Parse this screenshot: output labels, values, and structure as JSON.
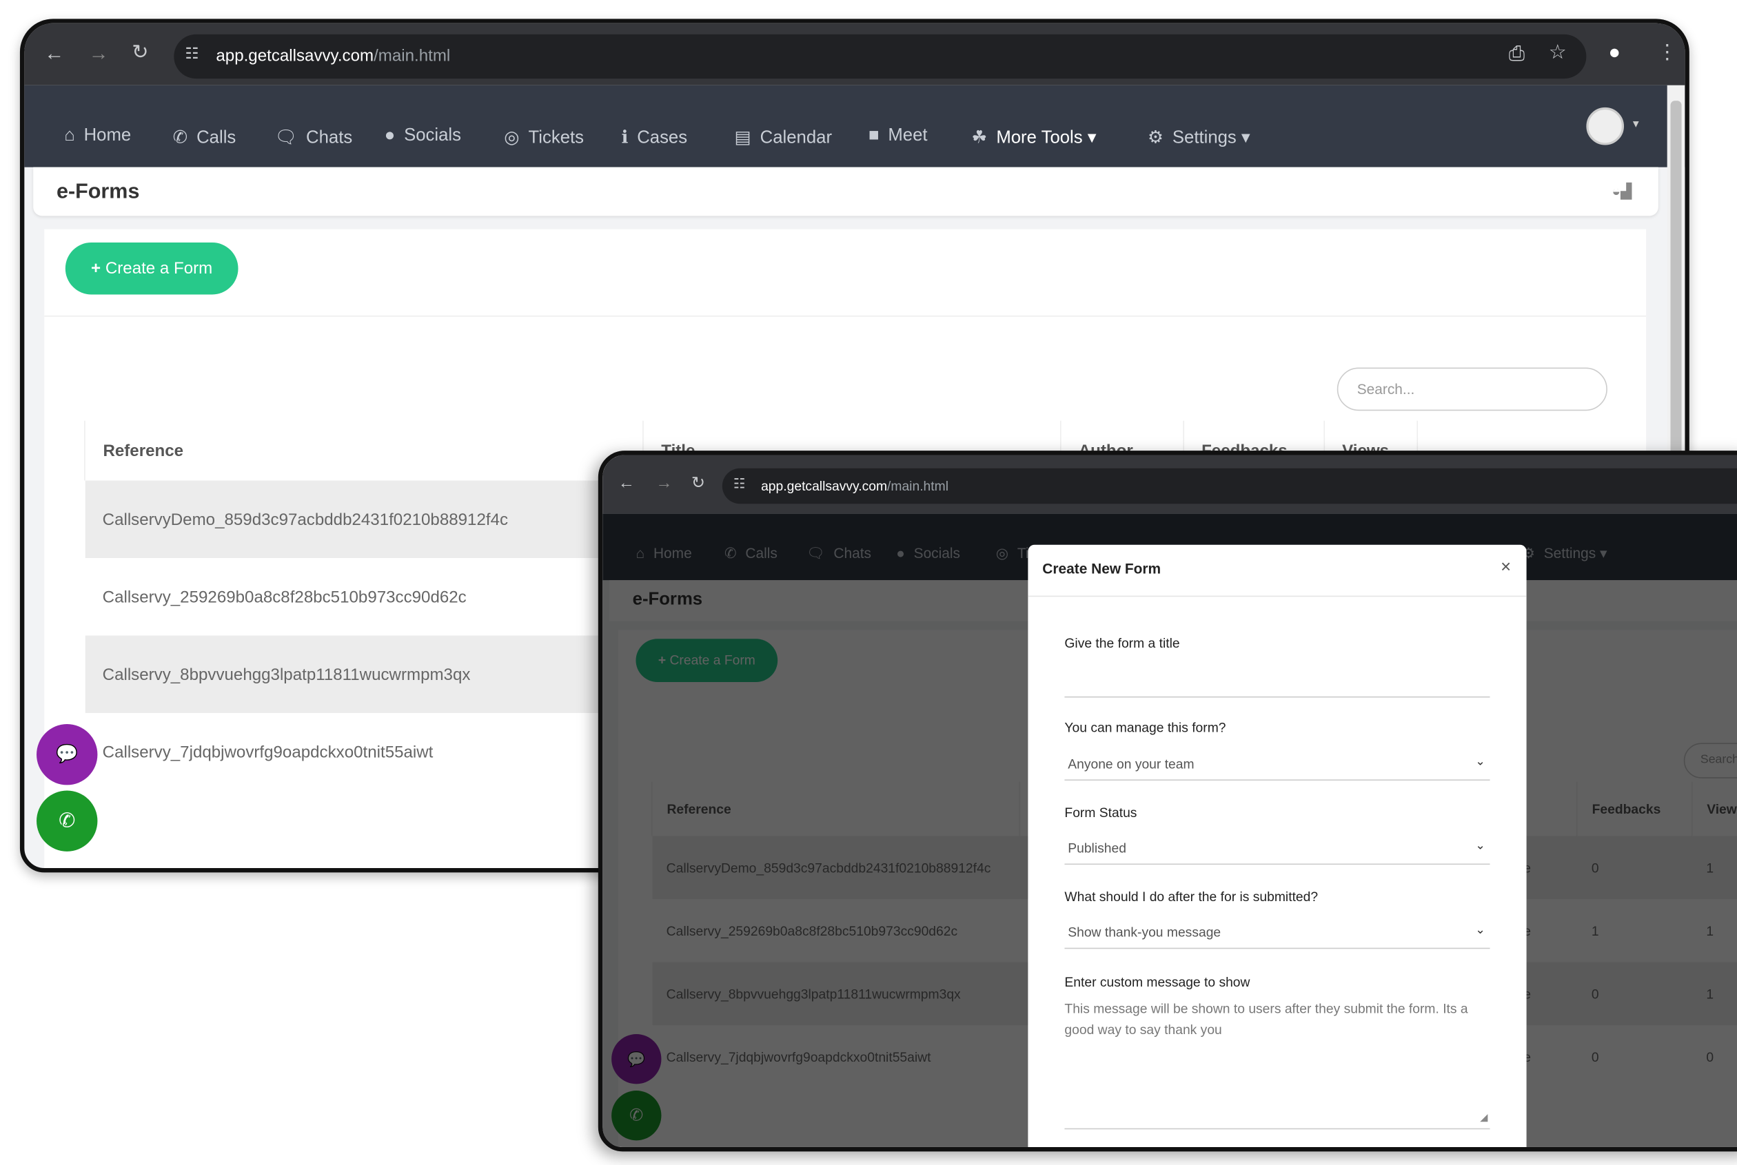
{
  "browser": {
    "url_host": "app.getcallsavvy.com",
    "url_path": "/main.html"
  },
  "nav": {
    "items": [
      {
        "label": "Home",
        "icon": "home-icon",
        "glyph": "⌂"
      },
      {
        "label": "Calls",
        "icon": "phone-icon",
        "glyph": "✆"
      },
      {
        "label": "Chats",
        "icon": "chat-icon",
        "glyph": "🗨"
      },
      {
        "label": "Socials",
        "icon": "comments-icon",
        "glyph": "●"
      },
      {
        "label": "Tickets",
        "icon": "lifebuoy-icon",
        "glyph": "◎"
      },
      {
        "label": "Cases",
        "icon": "info-icon",
        "glyph": "ℹ"
      },
      {
        "label": "Calendar",
        "icon": "calendar-icon",
        "glyph": "▤"
      },
      {
        "label": "Meet",
        "icon": "video-icon",
        "glyph": "■"
      },
      {
        "label": "More Tools ▾",
        "icon": "cubes-icon",
        "glyph": "☘"
      },
      {
        "label": "Settings ▾",
        "icon": "gears-icon",
        "glyph": "⚙"
      }
    ]
  },
  "page": {
    "title": "e-Forms",
    "create_label": "Create a Form",
    "search_placeholder": "Search..."
  },
  "table": {
    "headers": [
      "Reference",
      "Title",
      "Author",
      "Feedbacks",
      "Views"
    ],
    "rows": [
      {
        "reference": "CallservyDemo_859d3c97acbddb2431f0210b88912f4c",
        "author_visible": "ite",
        "feedbacks": "0",
        "views": "1"
      },
      {
        "reference": "Callservy_259269b0a8c8f28bc510b973cc90d62c",
        "author_visible": "ite",
        "feedbacks": "1",
        "views": "1"
      },
      {
        "reference": "Callservy_8bpvvuehgg3lpatp11811wucwrmpm3qx",
        "author_visible": "ite",
        "feedbacks": "0",
        "views": "1"
      },
      {
        "reference": "Callservy_7jdqbjwovrfg9oapdckxo0tnit55aiwt",
        "author_visible": "ite",
        "feedbacks": "0",
        "views": "0"
      }
    ]
  },
  "modal": {
    "title": "Create New Form",
    "close": "×",
    "title_label": "Give the form a title",
    "title_value": "",
    "manage_label": "You can manage this form?",
    "manage_value": "Anyone on your team",
    "status_label": "Form Status",
    "status_value": "Published",
    "after_label": "What should I do after the for is submitted?",
    "after_value": "Show thank-you message",
    "message_label": "Enter custom message to show",
    "message_placeholder": "This message will be shown to users after they submit the form. Its a good way to say thank you"
  },
  "colors": {
    "nav_bg": "#343a46",
    "green": "#27c98a",
    "chat_fab": "#8e24aa",
    "phone_fab": "#1b9a2a"
  }
}
